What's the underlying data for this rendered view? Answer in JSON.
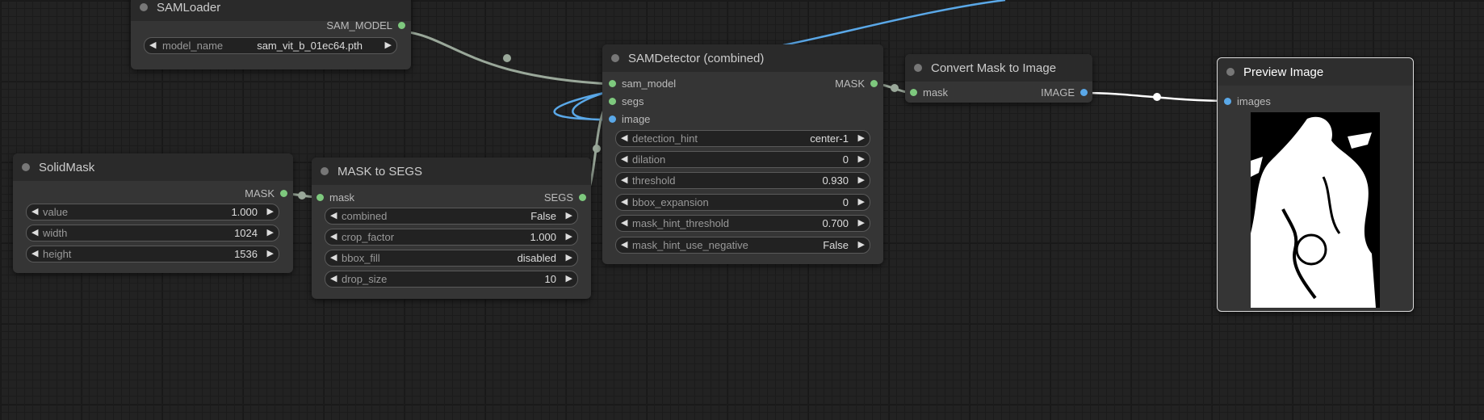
{
  "nodes": {
    "sam_loader": {
      "title": "SAMLoader",
      "output": "SAM_MODEL",
      "widgets": [
        {
          "name": "model_name",
          "value": "sam_vit_b_01ec64.pth"
        }
      ]
    },
    "solid_mask": {
      "title": "SolidMask",
      "output": "MASK",
      "widgets": [
        {
          "name": "value",
          "value": "1.000"
        },
        {
          "name": "width",
          "value": "1024"
        },
        {
          "name": "height",
          "value": "1536"
        }
      ]
    },
    "mask_to_segs": {
      "title": "MASK to SEGS",
      "input": "mask",
      "output": "SEGS",
      "widgets": [
        {
          "name": "combined",
          "value": "False"
        },
        {
          "name": "crop_factor",
          "value": "1.000"
        },
        {
          "name": "bbox_fill",
          "value": "disabled"
        },
        {
          "name": "drop_size",
          "value": "10"
        }
      ]
    },
    "sam_detector": {
      "title": "SAMDetector (combined)",
      "inputs": [
        "sam_model",
        "segs",
        "image"
      ],
      "output": "MASK",
      "widgets": [
        {
          "name": "detection_hint",
          "value": "center-1"
        },
        {
          "name": "dilation",
          "value": "0"
        },
        {
          "name": "threshold",
          "value": "0.930"
        },
        {
          "name": "bbox_expansion",
          "value": "0"
        },
        {
          "name": "mask_hint_threshold",
          "value": "0.700"
        },
        {
          "name": "mask_hint_use_negative",
          "value": "False"
        }
      ]
    },
    "convert_mask": {
      "title": "Convert Mask to Image",
      "input": "mask",
      "output": "IMAGE"
    },
    "preview_image": {
      "title": "Preview Image",
      "input": "images"
    }
  },
  "colors": {
    "canvas": "#222222",
    "node_body": "#353535",
    "node_title": "#2a2a2a",
    "mask_link": "#9aa89a",
    "image_link": "#5aa8e8",
    "slot_green": "#7ec97e",
    "slot_blue": "#5aa8e8"
  }
}
